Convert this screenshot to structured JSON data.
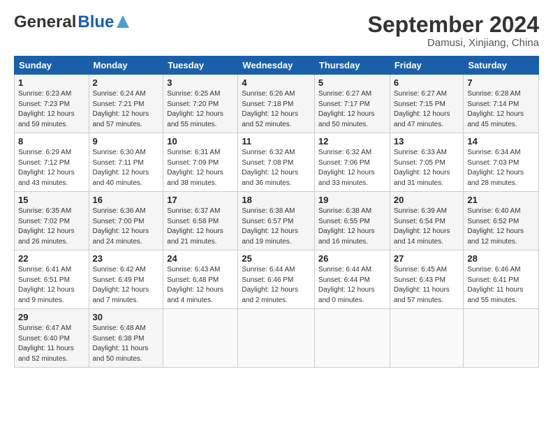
{
  "header": {
    "logo_general": "General",
    "logo_blue": "Blue",
    "month_title": "September 2024",
    "location": "Damusi, Xinjiang, China"
  },
  "days_of_week": [
    "Sunday",
    "Monday",
    "Tuesday",
    "Wednesday",
    "Thursday",
    "Friday",
    "Saturday"
  ],
  "weeks": [
    [
      {
        "day": "1",
        "sunrise": "Sunrise: 6:23 AM",
        "sunset": "Sunset: 7:23 PM",
        "daylight": "Daylight: 12 hours and 59 minutes."
      },
      {
        "day": "2",
        "sunrise": "Sunrise: 6:24 AM",
        "sunset": "Sunset: 7:21 PM",
        "daylight": "Daylight: 12 hours and 57 minutes."
      },
      {
        "day": "3",
        "sunrise": "Sunrise: 6:25 AM",
        "sunset": "Sunset: 7:20 PM",
        "daylight": "Daylight: 12 hours and 55 minutes."
      },
      {
        "day": "4",
        "sunrise": "Sunrise: 6:26 AM",
        "sunset": "Sunset: 7:18 PM",
        "daylight": "Daylight: 12 hours and 52 minutes."
      },
      {
        "day": "5",
        "sunrise": "Sunrise: 6:27 AM",
        "sunset": "Sunset: 7:17 PM",
        "daylight": "Daylight: 12 hours and 50 minutes."
      },
      {
        "day": "6",
        "sunrise": "Sunrise: 6:27 AM",
        "sunset": "Sunset: 7:15 PM",
        "daylight": "Daylight: 12 hours and 47 minutes."
      },
      {
        "day": "7",
        "sunrise": "Sunrise: 6:28 AM",
        "sunset": "Sunset: 7:14 PM",
        "daylight": "Daylight: 12 hours and 45 minutes."
      }
    ],
    [
      {
        "day": "8",
        "sunrise": "Sunrise: 6:29 AM",
        "sunset": "Sunset: 7:12 PM",
        "daylight": "Daylight: 12 hours and 43 minutes."
      },
      {
        "day": "9",
        "sunrise": "Sunrise: 6:30 AM",
        "sunset": "Sunset: 7:11 PM",
        "daylight": "Daylight: 12 hours and 40 minutes."
      },
      {
        "day": "10",
        "sunrise": "Sunrise: 6:31 AM",
        "sunset": "Sunset: 7:09 PM",
        "daylight": "Daylight: 12 hours and 38 minutes."
      },
      {
        "day": "11",
        "sunrise": "Sunrise: 6:32 AM",
        "sunset": "Sunset: 7:08 PM",
        "daylight": "Daylight: 12 hours and 36 minutes."
      },
      {
        "day": "12",
        "sunrise": "Sunrise: 6:32 AM",
        "sunset": "Sunset: 7:06 PM",
        "daylight": "Daylight: 12 hours and 33 minutes."
      },
      {
        "day": "13",
        "sunrise": "Sunrise: 6:33 AM",
        "sunset": "Sunset: 7:05 PM",
        "daylight": "Daylight: 12 hours and 31 minutes."
      },
      {
        "day": "14",
        "sunrise": "Sunrise: 6:34 AM",
        "sunset": "Sunset: 7:03 PM",
        "daylight": "Daylight: 12 hours and 28 minutes."
      }
    ],
    [
      {
        "day": "15",
        "sunrise": "Sunrise: 6:35 AM",
        "sunset": "Sunset: 7:02 PM",
        "daylight": "Daylight: 12 hours and 26 minutes."
      },
      {
        "day": "16",
        "sunrise": "Sunrise: 6:36 AM",
        "sunset": "Sunset: 7:00 PM",
        "daylight": "Daylight: 12 hours and 24 minutes."
      },
      {
        "day": "17",
        "sunrise": "Sunrise: 6:37 AM",
        "sunset": "Sunset: 6:58 PM",
        "daylight": "Daylight: 12 hours and 21 minutes."
      },
      {
        "day": "18",
        "sunrise": "Sunrise: 6:38 AM",
        "sunset": "Sunset: 6:57 PM",
        "daylight": "Daylight: 12 hours and 19 minutes."
      },
      {
        "day": "19",
        "sunrise": "Sunrise: 6:38 AM",
        "sunset": "Sunset: 6:55 PM",
        "daylight": "Daylight: 12 hours and 16 minutes."
      },
      {
        "day": "20",
        "sunrise": "Sunrise: 6:39 AM",
        "sunset": "Sunset: 6:54 PM",
        "daylight": "Daylight: 12 hours and 14 minutes."
      },
      {
        "day": "21",
        "sunrise": "Sunrise: 6:40 AM",
        "sunset": "Sunset: 6:52 PM",
        "daylight": "Daylight: 12 hours and 12 minutes."
      }
    ],
    [
      {
        "day": "22",
        "sunrise": "Sunrise: 6:41 AM",
        "sunset": "Sunset: 6:51 PM",
        "daylight": "Daylight: 12 hours and 9 minutes."
      },
      {
        "day": "23",
        "sunrise": "Sunrise: 6:42 AM",
        "sunset": "Sunset: 6:49 PM",
        "daylight": "Daylight: 12 hours and 7 minutes."
      },
      {
        "day": "24",
        "sunrise": "Sunrise: 6:43 AM",
        "sunset": "Sunset: 6:48 PM",
        "daylight": "Daylight: 12 hours and 4 minutes."
      },
      {
        "day": "25",
        "sunrise": "Sunrise: 6:44 AM",
        "sunset": "Sunset: 6:46 PM",
        "daylight": "Daylight: 12 hours and 2 minutes."
      },
      {
        "day": "26",
        "sunrise": "Sunrise: 6:44 AM",
        "sunset": "Sunset: 6:44 PM",
        "daylight": "Daylight: 12 hours and 0 minutes."
      },
      {
        "day": "27",
        "sunrise": "Sunrise: 6:45 AM",
        "sunset": "Sunset: 6:43 PM",
        "daylight": "Daylight: 11 hours and 57 minutes."
      },
      {
        "day": "28",
        "sunrise": "Sunrise: 6:46 AM",
        "sunset": "Sunset: 6:41 PM",
        "daylight": "Daylight: 11 hours and 55 minutes."
      }
    ],
    [
      {
        "day": "29",
        "sunrise": "Sunrise: 6:47 AM",
        "sunset": "Sunset: 6:40 PM",
        "daylight": "Daylight: 11 hours and 52 minutes."
      },
      {
        "day": "30",
        "sunrise": "Sunrise: 6:48 AM",
        "sunset": "Sunset: 6:38 PM",
        "daylight": "Daylight: 11 hours and 50 minutes."
      },
      null,
      null,
      null,
      null,
      null
    ]
  ]
}
